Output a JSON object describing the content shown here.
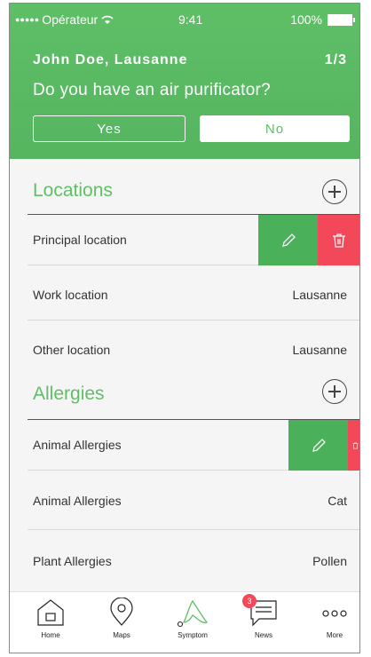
{
  "status": {
    "carrier": "Opérateur",
    "signal_dots": "●●●●●",
    "time": "9:41",
    "battery": "100%"
  },
  "header": {
    "user_location": "John Doe, Lausanne",
    "page_count": "1/3",
    "question": "Do you have an air purificator?",
    "yes_label": "Yes",
    "no_label": "No"
  },
  "locations": {
    "title": "Locations",
    "rows": [
      {
        "label": "Principal location",
        "value": ""
      },
      {
        "label": "Work location",
        "value": "Lausanne"
      },
      {
        "label": "Other location",
        "value": "Lausanne"
      }
    ]
  },
  "allergies": {
    "title": "Allergies",
    "rows": [
      {
        "label": "Animal Allergies",
        "value": ""
      },
      {
        "label": "Animal Allergies",
        "value": "Cat"
      },
      {
        "label": "Plant Allergies",
        "value": "Pollen"
      }
    ]
  },
  "tabbar": {
    "items": [
      {
        "label": "Home",
        "icon": "home-icon"
      },
      {
        "label": "Maps",
        "icon": "map-pin-icon"
      },
      {
        "label": "Symptom",
        "icon": "symptom-icon"
      },
      {
        "label": "News",
        "icon": "news-icon",
        "badge": "3"
      },
      {
        "label": "More",
        "icon": "more-icon"
      }
    ]
  },
  "colors": {
    "brand_green": "#5fbf67",
    "delete_red": "#f2485a"
  }
}
